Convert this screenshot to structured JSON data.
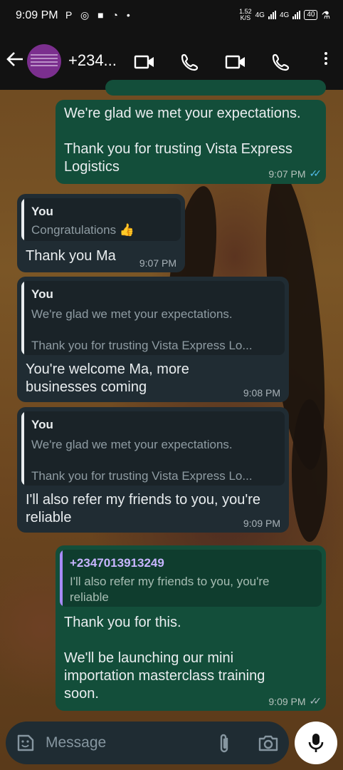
{
  "status_bar": {
    "time": "9:09 PM",
    "icons": [
      "P",
      "whatsapp-icon",
      "square-icon",
      "clock-icon",
      "•"
    ],
    "net_speed": "1.52",
    "net_unit": "K/S",
    "net1": "4G",
    "net2": "4G",
    "battery": "40"
  },
  "header": {
    "contact_name": "+234...",
    "icons": [
      "back-arrow-icon",
      "video-call-icon",
      "voice-call-icon",
      "video-call-icon",
      "voice-call-icon",
      "more-vert-icon"
    ]
  },
  "messages": [
    {
      "direction": "outgoing",
      "text": "We're glad we met your expectations.\n\nThank you for trusting Vista Express Logistics",
      "time": "9:07 PM",
      "status": "read"
    },
    {
      "direction": "incoming",
      "quote_author": "You",
      "quote_text": "Congratulations 👍",
      "text": "Thank you Ma",
      "time": "9:07 PM"
    },
    {
      "direction": "incoming",
      "quote_author": "You",
      "quote_text": "We're glad we met your expectations.\n\nThank you for trusting Vista Express Lo...",
      "text": "You're welcome Ma, more businesses coming",
      "time": "9:08 PM"
    },
    {
      "direction": "incoming",
      "quote_author": "You",
      "quote_text": "We're glad we met your expectations.\n\nThank you for trusting Vista Express Lo...",
      "text": "I'll also refer my friends to you, you're reliable",
      "time": "9:09 PM"
    },
    {
      "direction": "outgoing",
      "quote_author": "+2347013913249",
      "quote_text": "I'll also refer my friends to you, you're reliable",
      "text": "Thank you for this.\n\nWe'll be launching our mini importation masterclass training soon.",
      "time": "9:09 PM",
      "status": "delivered"
    }
  ],
  "input": {
    "placeholder": "Message"
  },
  "colors": {
    "outgoing_bubble": "#134e3a",
    "incoming_bubble": "#202c33",
    "read_ticks": "#53bdeb",
    "quote_you": "#e9edef",
    "quote_other": "#a78bfa"
  }
}
